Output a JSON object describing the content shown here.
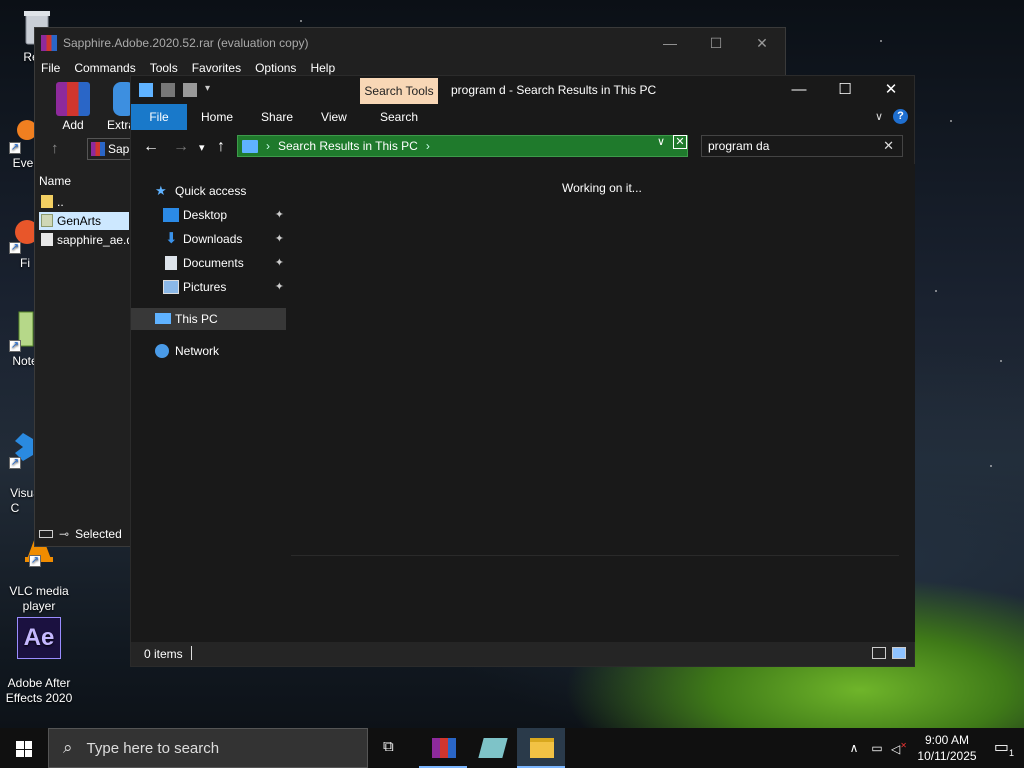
{
  "desktop": {
    "icons": [
      {
        "label": "Recy"
      },
      {
        "label": "Ever"
      },
      {
        "label": "Fi"
      },
      {
        "label": "Note"
      },
      {
        "label": "Visua\nC"
      },
      {
        "label": "VLC media\nplayer"
      },
      {
        "label": "Adobe After\nEffects 2020",
        "badge": "Ae"
      }
    ]
  },
  "winrar": {
    "title": "Sapphire.Adobe.2020.52.rar (evaluation copy)",
    "menu": [
      "File",
      "Commands",
      "Tools",
      "Favorites",
      "Options",
      "Help"
    ],
    "tools": [
      "Add",
      "Extra"
    ],
    "path_fragment": "Sapp",
    "column_name": "Name",
    "rows": [
      "..",
      "GenArts",
      "sapphire_ae.dl"
    ],
    "status": "Selected"
  },
  "explorer": {
    "search_tools_label": "Search Tools",
    "title": "program d - Search Results in This PC",
    "ribbon": {
      "file": "File",
      "home": "Home",
      "share": "Share",
      "view": "View",
      "search": "Search"
    },
    "address": "Search Results in This PC",
    "search_value": "program da",
    "nav": {
      "quick_access": "Quick access",
      "desktop": "Desktop",
      "downloads": "Downloads",
      "documents": "Documents",
      "pictures": "Pictures",
      "this_pc": "This PC",
      "network": "Network"
    },
    "working": "Working on it...",
    "status_count": "0 items",
    "help": "?"
  },
  "taskbar": {
    "search_placeholder": "Type here to search",
    "time": "9:00 AM",
    "date": "10/11/2025",
    "notif_count": "1"
  },
  "colors": {
    "accent": "#1979ca",
    "address_bg": "#1f7a2c",
    "search_tools_tab": "#f8d7b6"
  }
}
